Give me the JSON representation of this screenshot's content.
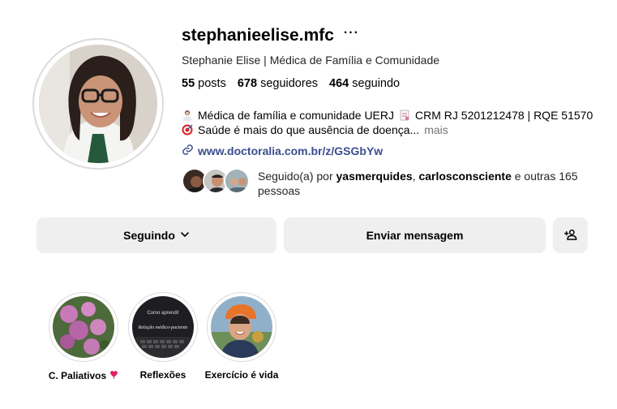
{
  "profile": {
    "username": "stephanieelise.mfc",
    "more_label": "···",
    "full_name": "Stephanie Elise | Médica de Família e Comunidade",
    "stats": {
      "posts_count": "55",
      "posts_label": "posts",
      "followers_count": "678",
      "followers_label": "seguidores",
      "following_count": "464",
      "following_label": "seguindo"
    },
    "bio": {
      "line1_a": "Médica de família e comunidade UERJ",
      "line1_b": "CRM RJ 5201212478 | RQE 51570",
      "line2": "Saúde é mais do que ausência de doença...",
      "more": "mais"
    },
    "link": "www.doctoralia.com.br/z/GSGbYw",
    "followed_by": {
      "prefix": "Seguido(a) por",
      "user1": "yasmerquides",
      "separator": ",",
      "user2": "carlosconsciente",
      "suffix": "e outras 165 pessoas"
    }
  },
  "buttons": {
    "following": "Seguindo",
    "message": "Enviar mensagem"
  },
  "highlights": [
    {
      "label": "C. Paliativos"
    },
    {
      "label": "Reflexões"
    },
    {
      "label": "Exercício é vida"
    }
  ],
  "highlight_texts": {
    "h2_top": "Como aprendi!",
    "h2_mid": "Relação médico-paciente"
  },
  "colors": {
    "link": "#3b4d8f",
    "button_bg": "#efefef",
    "muted": "#737373",
    "heart": "#e0245e"
  },
  "icons": [
    "more-icon",
    "link-icon",
    "chevron-down-icon",
    "add-user-icon",
    "heart-icon",
    "doctor-emoji-icon",
    "document-emoji-icon",
    "target-emoji-icon"
  ]
}
